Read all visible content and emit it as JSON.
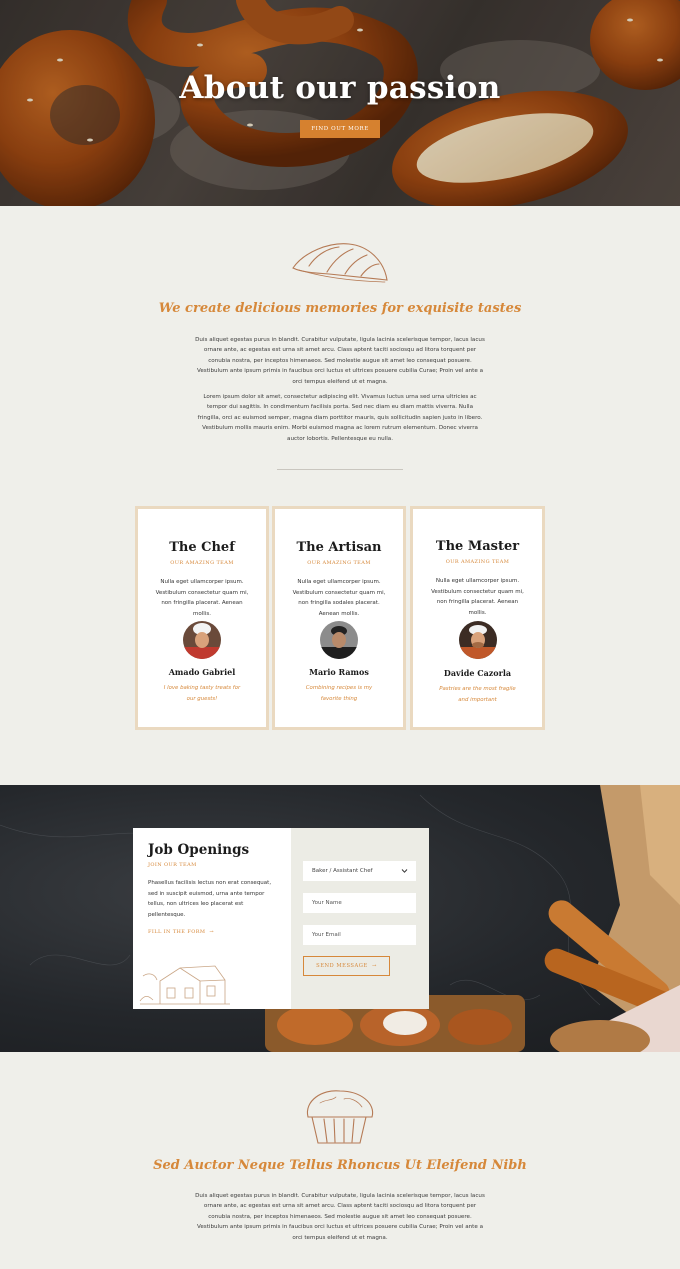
{
  "hero": {
    "title": "About our passion",
    "button_label": "FIND OUT MORE"
  },
  "intro": {
    "heading": "We create delicious memories for exquisite tastes",
    "paragraph_1": "Duis aliquet egestas purus in blandit. Curabitur vulputate, ligula lacinia scelerisque tempor, lacus lacus ornare ante, ac egestas est urna sit amet arcu. Class aptent taciti sociosqu ad litora torquent per conubia nostra, per inceptos himenaeos. Sed molestie augue sit amet leo consequat posuere. Vestibulum ante ipsum primis in faucibus orci luctus et ultrices posuere cubilia Curae; Proin vel ante a orci tempus eleifend ut et magna.",
    "paragraph_2": "Lorem ipsum dolor sit amet, consectetur adipiscing elit. Vivamus luctus urna sed urna ultricies ac tempor dui sagittis. In condimentum facilisis porta. Sed nec diam eu diam mattis viverra. Nulla fringilla, orci ac euismod semper, magna diam porttitor mauris, quis sollicitudin sapien justo in libero. Vestibulum mollis mauris enim. Morbi euismod magna ac lorem rutrum elementum. Donec viverra auctor lobortis. Pellentesque eu nulla."
  },
  "team": [
    {
      "title": "The Chef",
      "subtitle": "OUR AMAZING TEAM",
      "text": "Nulla eget ullamcorper ipsum. Vestibulum consectetur quam mi, non fringilla placerat. Aenean mollis.",
      "name": "Amado Gabriel",
      "quote": "I love baking tasty treats for our guests!"
    },
    {
      "title": "The Artisan",
      "subtitle": "OUR AMAZING TEAM",
      "text": "Nulla eget ullamcorper ipsum. Vestibulum consectetur quam mi, non fringilla sodales placerat. Aenean mollis.",
      "name": "Mario Ramos",
      "quote": "Combining recipes is my favorite thing"
    },
    {
      "title": "The Master",
      "subtitle": "OUR AMAZING TEAM",
      "text": "Nulla eget ullamcorper ipsum. Vestibulum consectetur quam mi, non fringilla placerat. Aenean mollis.",
      "name": "Davide Cazorla",
      "quote": "Pastries are the most fragile and important"
    }
  ],
  "jobs": {
    "title": "Job Openings",
    "subtitle": "JOIN OUR TEAM",
    "text": "Phasellus facilisis lectus non erat consequat, sed in suscipit euismod, urna ante tempor tellus, non ultrices leo placerat est pellentesque.",
    "link_label": "FILL IN THE FORM",
    "position_value": "Baker / Assistant Chef",
    "name_placeholder": "Your Name",
    "email_placeholder": "Your Email",
    "send_label": "SEND MESSAGE"
  },
  "bottom": {
    "heading": "Sed Auctor Neque Tellus Rhoncus Ut Eleifend Nibh",
    "paragraph": "Duis aliquet egestas purus in blandit. Curabitur vulputate, ligula lacinia scelerisque tempor, lacus lacus ornare ante, ac egestas est urna sit amet arcu. Class aptent taciti sociosqu ad litora torquent per conubia nostra, per inceptos himenaeos. Sed molestie augue sit amet leo consequat posuere. Vestibulum ante ipsum primis in faucibus orci luctus et ultrices posuere cubilia Curae; Proin vel ante a orci tempus eleifend ut et magna."
  },
  "colors": {
    "accent": "#d6883a",
    "background": "#efefea",
    "card_border": "#ead9c0",
    "dark_section": "#24272b"
  },
  "icons": [
    "croissant-sketch-icon",
    "chevron-down-icon",
    "arrow-right-icon",
    "muffin-sketch-icon",
    "bakery-house-sketch-icon"
  ]
}
